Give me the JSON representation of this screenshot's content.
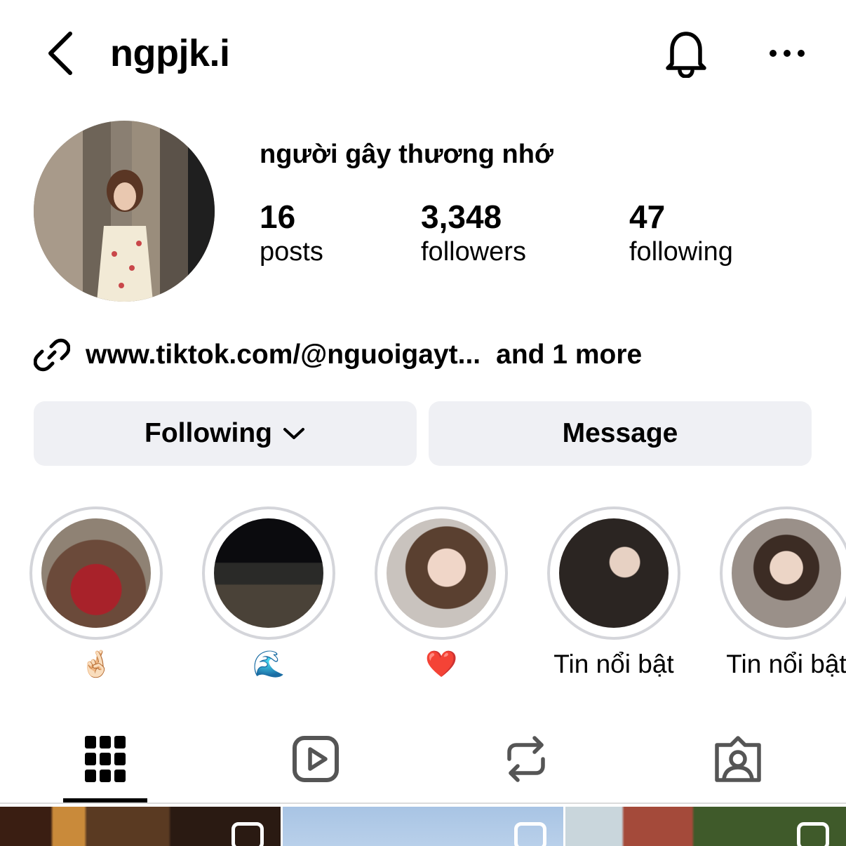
{
  "header": {
    "username": "ngpjk.i",
    "icons": {
      "back": "chevron-left-icon",
      "notifications": "bell-icon",
      "more": "more-horizontal-icon"
    }
  },
  "profile": {
    "display_name": "người gây thương nhớ",
    "stats": [
      {
        "value": "16",
        "label": "posts"
      },
      {
        "value": "3,348",
        "label": "followers"
      },
      {
        "value": "47",
        "label": "following"
      }
    ],
    "link": {
      "icon": "link-icon",
      "text": "www.tiktok.com/@nguoigayt...",
      "more": "and 1 more"
    }
  },
  "actions": {
    "following_label": "Following",
    "message_label": "Message"
  },
  "highlights": [
    {
      "label": "🤞🏻"
    },
    {
      "label": "🌊"
    },
    {
      "label": "❤️"
    },
    {
      "label": "Tin nổi bật"
    },
    {
      "label": "Tin nổi bật"
    }
  ],
  "tabs": [
    {
      "icon": "grid-icon",
      "active": true
    },
    {
      "icon": "reels-icon",
      "active": false
    },
    {
      "icon": "reposts-icon",
      "active": false
    },
    {
      "icon": "tagged-icon",
      "active": false
    }
  ],
  "colors": {
    "button_bg": "#eff0f4",
    "highlight_ring": "#d4d5da",
    "divider": "#dbdbdb"
  }
}
